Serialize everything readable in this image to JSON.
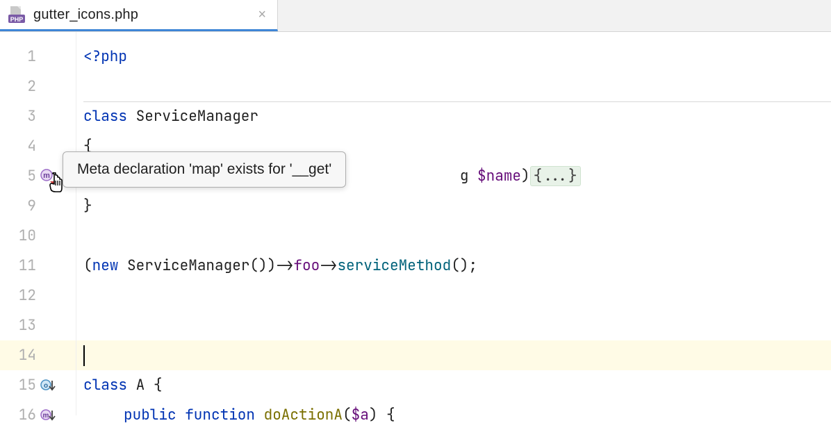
{
  "tab": {
    "filename": "gutter_icons.php",
    "close_label": "×"
  },
  "tooltip": {
    "text": "Meta declaration 'map' exists for '__get'"
  },
  "gutter_lines": [
    "1",
    "2",
    "3",
    "4",
    "5",
    "9",
    "10",
    "11",
    "12",
    "13",
    "14",
    "15",
    "16"
  ],
  "gutter_icons": {
    "line5": "meta-icon",
    "line15": "override-icon",
    "line16": "meta-down-icon"
  },
  "code": {
    "l1_open": "<?php",
    "l3_class_kw": "class ",
    "l3_class_name": "ServiceManager",
    "l4_brace": "{",
    "l5_visible_suffix_g": "g ",
    "l5_var": "$name",
    "l5_rparen": ")",
    "l5_fold": "{...}",
    "l9_brace": "}",
    "l11_pre": "(",
    "l11_new": "new ",
    "l11_class": "ServiceManager",
    "l11_mid": "())->",
    "l11_foo": "foo",
    "l11_arrow": "->",
    "l11_method": "serviceMethod",
    "l11_post": "();",
    "l15_class_kw": "class ",
    "l15_class_name": "A ",
    "l15_brace": "{",
    "l16_public": "public ",
    "l16_function": "function ",
    "l16_fn": "doActionA",
    "l16_lparen": "(",
    "l16_var": "$a",
    "l16_rparen_brace": ") {"
  },
  "colors": {
    "keyword": "#0033b3",
    "variable": "#660e7a",
    "method": "#00627a",
    "function_name": "#7a6f00",
    "highlight": "#fffbe6",
    "fold_bg": "#e8f2e8",
    "tab_underline": "#3e86d6"
  }
}
